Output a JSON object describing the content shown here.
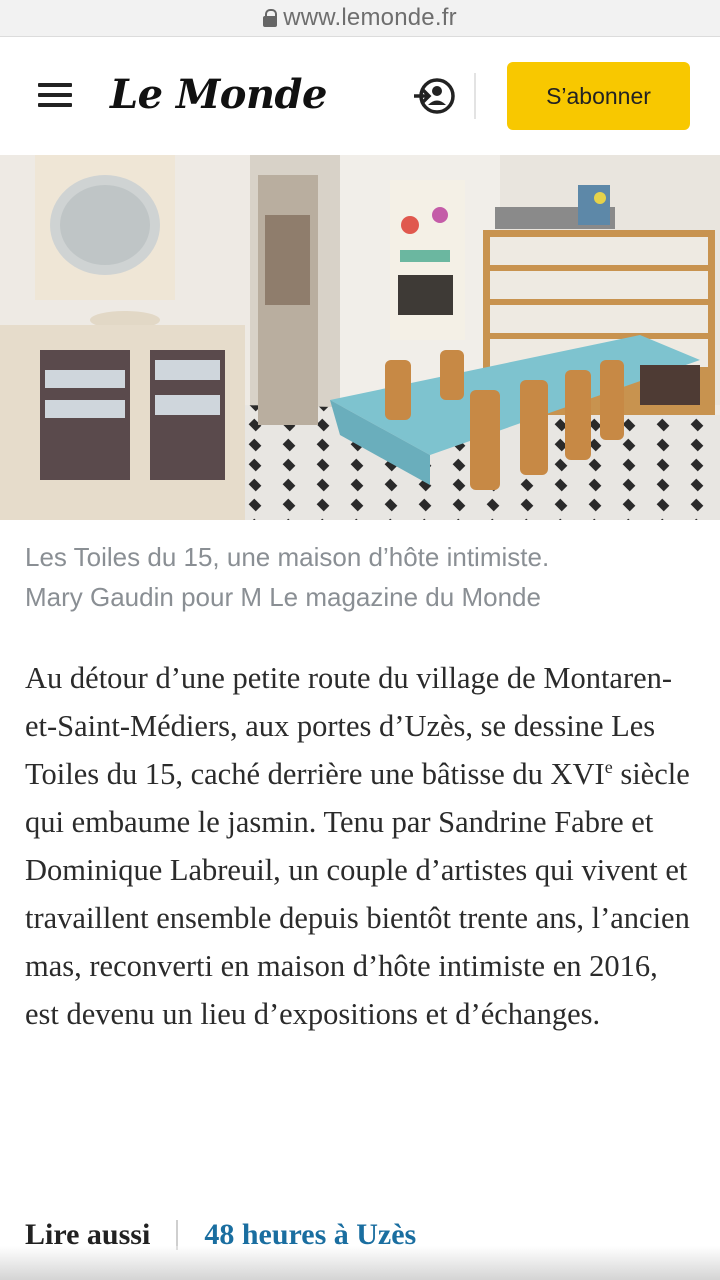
{
  "browser": {
    "url": "www.lemonde.fr"
  },
  "header": {
    "logo": "Le Monde",
    "subscribe_label": "S’abonner"
  },
  "article": {
    "caption_line1": "Les Toiles du 15, une maison d’hôte intimiste.",
    "caption_line2": "Mary Gaudin pour M Le magazine du Monde",
    "paragraph_before_sup": "Au détour d’une petite route du village de Montaren-et-Saint-Médiers, aux portes d’Uzès, se dessine Les Toiles du 15, caché derrière une bâtisse du XVI",
    "paragraph_sup": "e",
    "paragraph_after_sup": " siècle qui embaume le jasmin. Tenu par Sandrine Fabre et Dominique Labreuil, un couple d’artistes qui vivent et travaillent ensemble depuis bientôt trente ans, l’ancien mas, reconverti en maison d’hôte intimiste en 2016, est devenu un lieu d’expositions et d’échanges.",
    "read_also_label": "Lire aussi",
    "read_also_link": "48 heures à Uzès"
  },
  "colors": {
    "subscribe_bg": "#f8c800",
    "link": "#1a6ea0",
    "caption": "#8a8f94",
    "tablecloth": "#7ec3cf"
  },
  "icons": [
    "lock-icon",
    "menu-icon",
    "account-icon"
  ]
}
